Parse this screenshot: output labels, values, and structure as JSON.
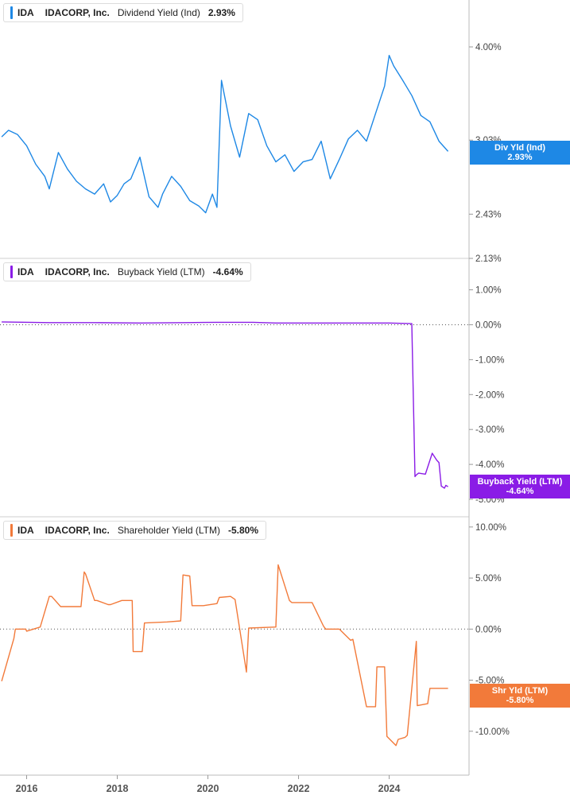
{
  "colors": {
    "dividend": "#1e88e5",
    "buyback": "#8a1ce6",
    "shareholder": "#f27a3a",
    "axis": "#bbbbbb",
    "zero_line": "#555555"
  },
  "x_axis": {
    "ticks": [
      "2016",
      "2018",
      "2020",
      "2022",
      "2024"
    ]
  },
  "panels": [
    {
      "key": "dividend",
      "legend": {
        "ticker": "IDA",
        "company": "IDACORP, Inc.",
        "metric": "Dividend Yield (Ind)",
        "value": "2.93%"
      },
      "badge": {
        "label": "Div Yld (Ind)",
        "value": "2.93%"
      },
      "y_ticks": [
        "4.00%",
        "3.03%",
        "2.43%",
        "2.13%"
      ]
    },
    {
      "key": "buyback",
      "legend": {
        "ticker": "IDA",
        "company": "IDACORP, Inc.",
        "metric": "Buyback Yield (LTM)",
        "value": "-4.64%"
      },
      "badge": {
        "label": "Buyback Yield (LTM)",
        "value": "-4.64%"
      },
      "y_ticks": [
        "1.00%",
        "0.00%",
        "-1.00%",
        "-2.00%",
        "-3.00%",
        "-4.00%",
        "-5.00%"
      ]
    },
    {
      "key": "shareholder",
      "legend": {
        "ticker": "IDA",
        "company": "IDACORP, Inc.",
        "metric": "Shareholder Yield (LTM)",
        "value": "-5.80%"
      },
      "badge": {
        "label": "Shr Yld (LTM)",
        "value": "-5.80%"
      },
      "y_ticks": [
        "10.00%",
        "5.00%",
        "0.00%",
        "-5.00%",
        "-10.00%"
      ]
    }
  ],
  "chart_data": [
    {
      "type": "line",
      "title": "IDACORP, Inc. Dividend Yield (Ind)",
      "ylabel": "",
      "y_scale": "log",
      "ylim": [
        2.13,
        4.6
      ],
      "y_ticks": [
        4.0,
        3.03,
        2.43,
        2.13
      ],
      "x": [
        2015.45,
        2015.6,
        2015.8,
        2016.0,
        2016.2,
        2016.4,
        2016.5,
        2016.7,
        2016.9,
        2017.1,
        2017.3,
        2017.5,
        2017.7,
        2017.85,
        2018.0,
        2018.15,
        2018.3,
        2018.5,
        2018.7,
        2018.9,
        2019.0,
        2019.2,
        2019.4,
        2019.6,
        2019.8,
        2019.95,
        2020.1,
        2020.2,
        2020.3,
        2020.5,
        2020.7,
        2020.9,
        2021.1,
        2021.3,
        2021.5,
        2021.7,
        2021.9,
        2022.1,
        2022.3,
        2022.5,
        2022.7,
        2022.9,
        2023.1,
        2023.3,
        2023.5,
        2023.7,
        2023.9,
        2024.0,
        2024.1,
        2024.3,
        2024.5,
        2024.7,
        2024.9,
        2025.1,
        2025.3
      ],
      "series": [
        {
          "values": [
            3.06,
            3.12,
            3.08,
            2.98,
            2.82,
            2.72,
            2.62,
            2.92,
            2.78,
            2.68,
            2.62,
            2.58,
            2.66,
            2.52,
            2.57,
            2.66,
            2.7,
            2.88,
            2.56,
            2.48,
            2.58,
            2.72,
            2.64,
            2.53,
            2.49,
            2.44,
            2.58,
            2.48,
            3.62,
            3.16,
            2.88,
            3.28,
            3.22,
            2.98,
            2.84,
            2.9,
            2.76,
            2.84,
            2.86,
            3.02,
            2.7,
            2.86,
            3.04,
            3.12,
            3.02,
            3.28,
            3.56,
            3.9,
            3.78,
            3.62,
            3.46,
            3.26,
            3.2,
            3.02,
            2.93
          ]
        }
      ]
    },
    {
      "type": "line",
      "title": "IDACORP, Inc. Buyback Yield (LTM)",
      "ylabel": "",
      "ylim": [
        -5.5,
        1.9
      ],
      "y_ticks": [
        1.0,
        0.0,
        -1.0,
        -2.0,
        -3.0,
        -4.0,
        -5.0
      ],
      "x": [
        2015.45,
        2016.5,
        2017.5,
        2018.5,
        2019.5,
        2020.2,
        2021.0,
        2021.5,
        2022.0,
        2023.0,
        2024.0,
        2024.5,
        2024.57,
        2024.6,
        2024.65,
        2024.8,
        2024.95,
        2025.05,
        2025.1,
        2025.15,
        2025.22,
        2025.25,
        2025.3
      ],
      "series": [
        {
          "values": [
            0.08,
            0.06,
            0.06,
            0.05,
            0.06,
            0.07,
            0.07,
            0.05,
            0.05,
            0.05,
            0.05,
            0.03,
            -4.35,
            -4.3,
            -4.25,
            -4.28,
            -3.68,
            -3.88,
            -3.95,
            -4.62,
            -4.68,
            -4.6,
            -4.64
          ]
        }
      ]
    },
    {
      "type": "line",
      "title": "IDACORP, Inc. Shareholder Yield (LTM)",
      "ylabel": "",
      "ylim": [
        -14.3,
        11.0
      ],
      "y_ticks": [
        10.0,
        5.0,
        0.0,
        -5.0,
        -10.0
      ],
      "x": [
        2015.45,
        2015.72,
        2015.75,
        2015.98,
        2016.0,
        2016.3,
        2016.5,
        2016.55,
        2016.75,
        2017.2,
        2017.27,
        2017.3,
        2017.5,
        2017.55,
        2017.8,
        2017.85,
        2018.1,
        2018.33,
        2018.35,
        2018.55,
        2018.6,
        2019.1,
        2019.4,
        2019.45,
        2019.6,
        2019.65,
        2019.9,
        2020.2,
        2020.25,
        2020.5,
        2020.6,
        2020.85,
        2020.9,
        2021.5,
        2021.55,
        2021.8,
        2021.85,
        2022.3,
        2022.55,
        2022.6,
        2022.9,
        2023.15,
        2023.2,
        2023.5,
        2023.7,
        2023.73,
        2023.9,
        2023.95,
        2024.15,
        2024.2,
        2024.35,
        2024.4,
        2024.6,
        2024.62,
        2024.85,
        2024.9,
        2025.3
      ],
      "series": [
        {
          "values": [
            -5.1,
            -0.9,
            0.0,
            0.0,
            -0.2,
            0.2,
            3.2,
            3.2,
            2.2,
            2.2,
            5.6,
            5.4,
            2.8,
            2.8,
            2.4,
            2.4,
            2.8,
            2.8,
            -2.2,
            -2.2,
            0.6,
            0.7,
            0.8,
            5.3,
            5.2,
            2.3,
            2.3,
            2.5,
            3.1,
            3.2,
            2.9,
            -4.2,
            0.1,
            0.2,
            6.3,
            2.8,
            2.6,
            2.6,
            0.3,
            0.0,
            0.0,
            -1.1,
            -1.0,
            -7.6,
            -7.6,
            -3.7,
            -3.7,
            -10.5,
            -11.4,
            -10.8,
            -10.6,
            -10.4,
            -1.2,
            -7.5,
            -7.3,
            -5.8,
            -5.8
          ]
        }
      ]
    }
  ]
}
